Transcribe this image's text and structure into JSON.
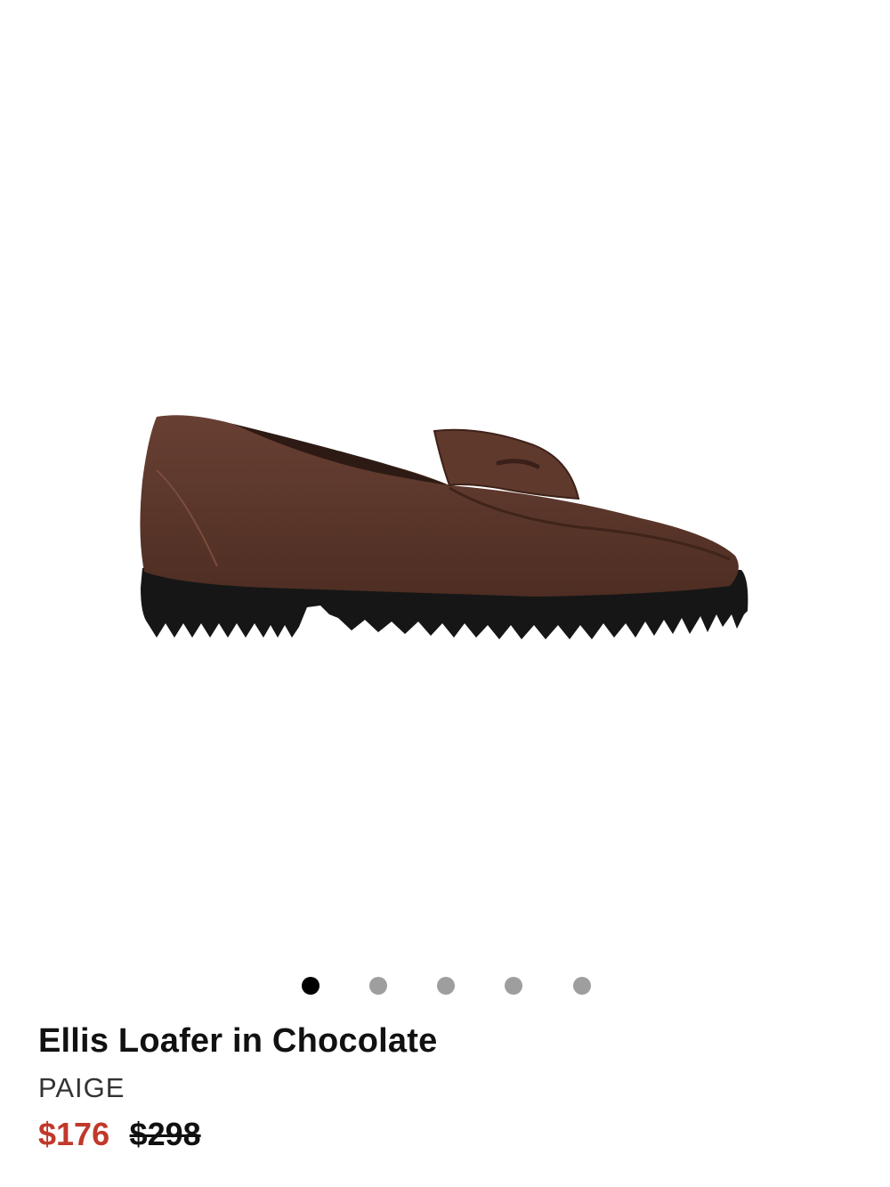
{
  "product": {
    "title": "Ellis Loafer in Chocolate",
    "brand": "PAIGE",
    "sale_price": "$176",
    "original_price": "$298",
    "image_icon": "loafer-shoe-image"
  },
  "carousel": {
    "total_images": 5,
    "active_index": 0
  },
  "colors": {
    "sale_price": "#c0392b",
    "active_dot": "#000000",
    "inactive_dot": "#9e9e9e",
    "suede": "#5a3427",
    "sole": "#161616"
  }
}
